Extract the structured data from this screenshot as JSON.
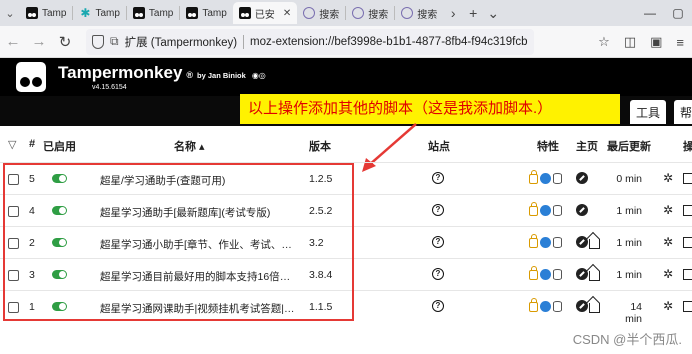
{
  "browser": {
    "tabs": [
      {
        "label": "Tamp",
        "icon": "tampermonkey-icon"
      },
      {
        "label": "Tamp",
        "icon": "teal-star-icon"
      },
      {
        "label": "Tamp",
        "icon": "tampermonkey-icon"
      },
      {
        "label": "Tamp",
        "icon": "tampermonkey-icon"
      },
      {
        "label": "已安",
        "icon": "tampermonkey-icon",
        "active": true
      },
      {
        "label": "搜索",
        "icon": "globe-icon"
      },
      {
        "label": "搜索",
        "icon": "globe-icon"
      },
      {
        "label": "搜索",
        "icon": "globe-icon"
      }
    ],
    "url_label": "扩展 (Tampermonkey)",
    "url": "moz-extension://bef3998e-b1b1-4877-8fb4-f94c319fcb"
  },
  "header": {
    "title": "Tampermonkey",
    "reg": "®",
    "by": "by Jan Biniok",
    "version": "v4.15.6154"
  },
  "tm_tabs": [
    {
      "label": "工具"
    },
    {
      "label": "帮"
    }
  ],
  "annotation": "以上操作添加其他的脚本（这是我添加脚本.）",
  "columns": {
    "num": "#",
    "enabled": "已启用",
    "name": "名称 ▴",
    "version": "版本",
    "site": "站点",
    "features": "特性",
    "home": "主页",
    "updated": "最后更新",
    "actions": "操"
  },
  "rows": [
    {
      "num": "5",
      "name": "超星/学习通助手(查题可用)",
      "version": "1.2.5",
      "updated": "0 min",
      "home_icons": [
        "homepage-icon"
      ]
    },
    {
      "num": "4",
      "name": "超星学习通助手[最新题库](考试专版)",
      "version": "2.5.2",
      "updated": "1 min",
      "home_icons": [
        "homepage-icon"
      ]
    },
    {
      "num": "2",
      "name": "超星学习通小助手[章节、作业、考试、视频]…",
      "version": "3.2",
      "updated": "1 min",
      "home_icons": [
        "homepage-icon",
        "house-icon"
      ]
    },
    {
      "num": "3",
      "name": "超星学习通目前最好用的脚本支持16倍速，…",
      "version": "3.8.4",
      "updated": "1 min",
      "home_icons": [
        "homepage-icon",
        "house-icon"
      ]
    },
    {
      "num": "1",
      "name": "超星学习通网课助手|视频挂机考试答题|全网…",
      "version": "1.1.5",
      "updated": "14 min",
      "home_icons": [
        "homepage-icon",
        "house-icon"
      ]
    }
  ],
  "watermark": "CSDN @半个西瓜."
}
